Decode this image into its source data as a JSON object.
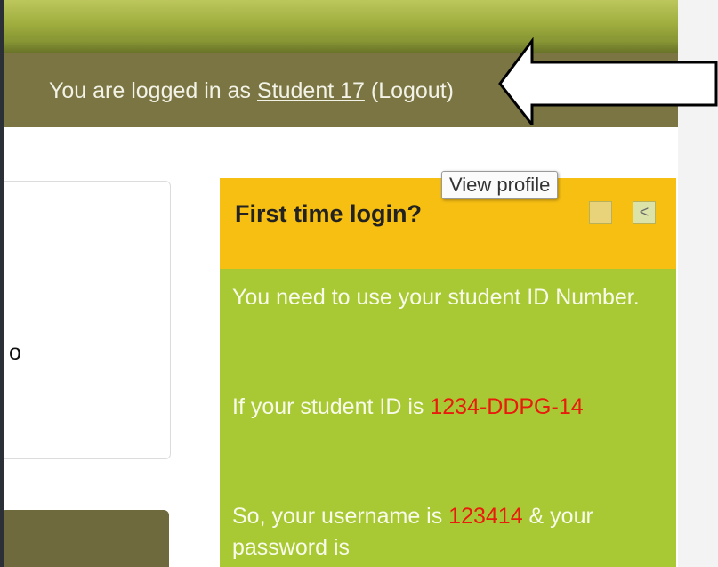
{
  "header": {
    "login_prefix": "You are logged in as ",
    "user_link": "Student 17",
    "login_suffix": " (Logout)"
  },
  "tooltip": {
    "text": "View profile"
  },
  "content_card": {
    "visible_char": "o"
  },
  "block": {
    "title": "First time login?",
    "controls": {
      "hide_icon": "hide-icon",
      "dock_icon": "dock-icon",
      "dock_glyph": "<"
    },
    "p1": "You need to use your student ID Number.",
    "p2_prefix": "If your student ID is ",
    "p2_id": "1234-DDPG-14",
    "p3_prefix": "So, your username is ",
    "p3_username": "123414",
    "p3_suffix": " & your password is"
  },
  "colors": {
    "login_bar": "#7a7543",
    "block_header": "#f7bf12",
    "block_body": "#a9c934",
    "highlight_red": "#e81c0d"
  }
}
